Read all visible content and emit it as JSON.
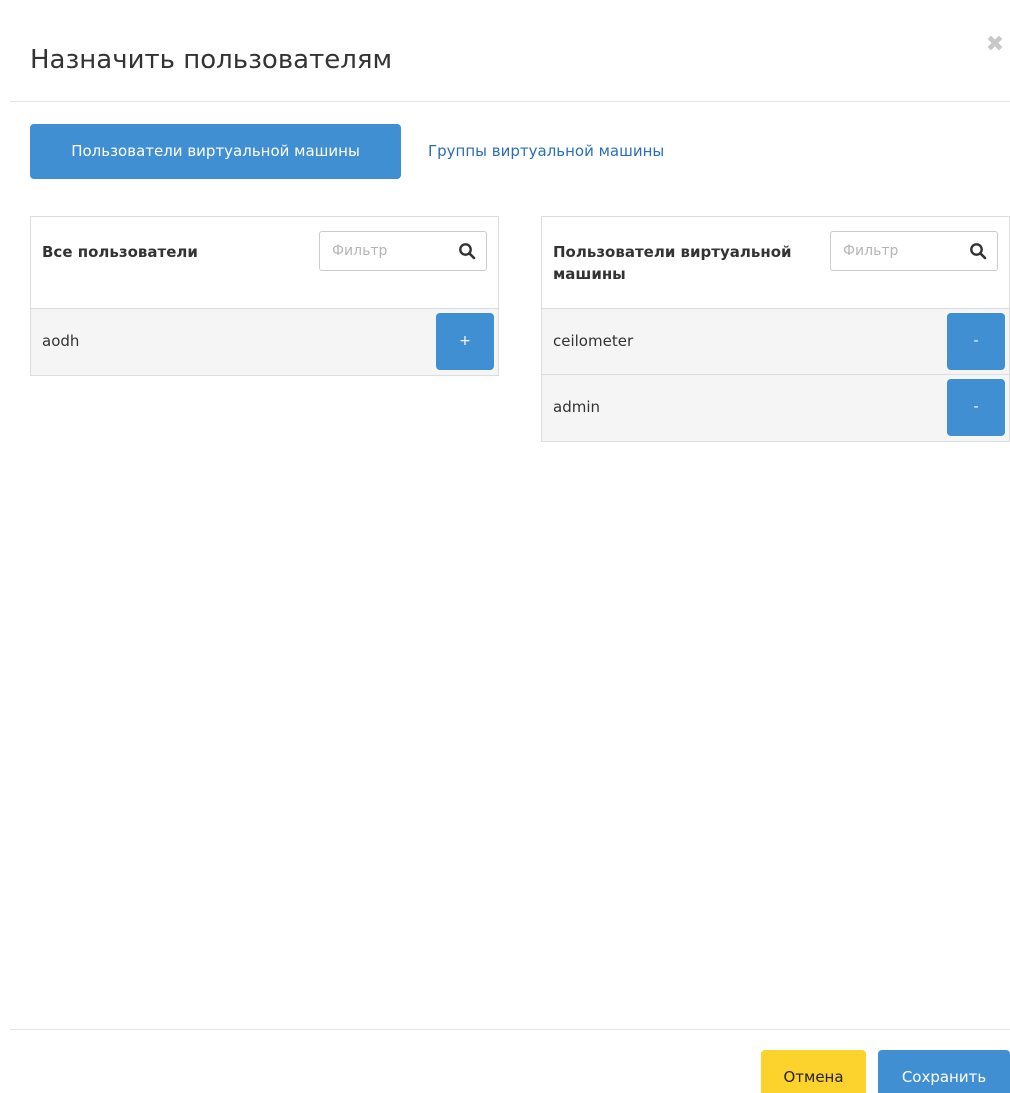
{
  "modal": {
    "title": "Назначить пользователям",
    "close_glyph": "✖"
  },
  "tabs": {
    "active_label": "Пользователи виртуальной машины",
    "inactive_label": "Группы виртуальной машины"
  },
  "left_panel": {
    "title": "Все пользователи",
    "filter_placeholder": "Фильтр",
    "items": [
      {
        "label": "aodh",
        "action": "+"
      }
    ]
  },
  "right_panel": {
    "title": "Пользователи виртуальной машины",
    "filter_placeholder": "Фильтр",
    "items": [
      {
        "label": "ceilometer",
        "action": "-"
      },
      {
        "label": "admin",
        "action": "-"
      }
    ]
  },
  "footer": {
    "cancel_label": "Отмена",
    "save_label": "Сохранить"
  },
  "colors": {
    "primary": "#3f8fd2",
    "link": "#2a6fb5",
    "cancel": "#fcd22c"
  },
  "icons": {
    "close": "close-icon",
    "search": "search-icon"
  }
}
